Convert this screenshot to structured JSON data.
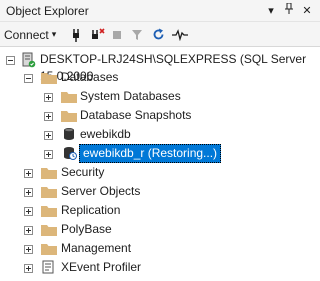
{
  "panel": {
    "title": "Object Explorer",
    "pin_glyph": "▾",
    "autohide_glyph": "ᛘ",
    "close_glyph": "✕"
  },
  "toolbar": {
    "connect_label": "Connect",
    "connect_arrow": "▾"
  },
  "tree": {
    "server": "DESKTOP-LRJ24SH\\SQLEXPRESS (SQL Server 15.0.2000",
    "databases": "Databases",
    "system_databases": "System Databases",
    "database_snapshots": "Database Snapshots",
    "ewebikdb": "ewebikdb",
    "restoring_db": "ewebikdb_r (Restoring...)",
    "security": "Security",
    "server_objects": "Server Objects",
    "replication": "Replication",
    "polybase": "PolyBase",
    "management": "Management",
    "xevent_profiler": "XEvent Profiler"
  },
  "colors": {
    "selection": "#0078d7",
    "folder": "#dcb67a",
    "server_green": "#2e9e3e"
  }
}
